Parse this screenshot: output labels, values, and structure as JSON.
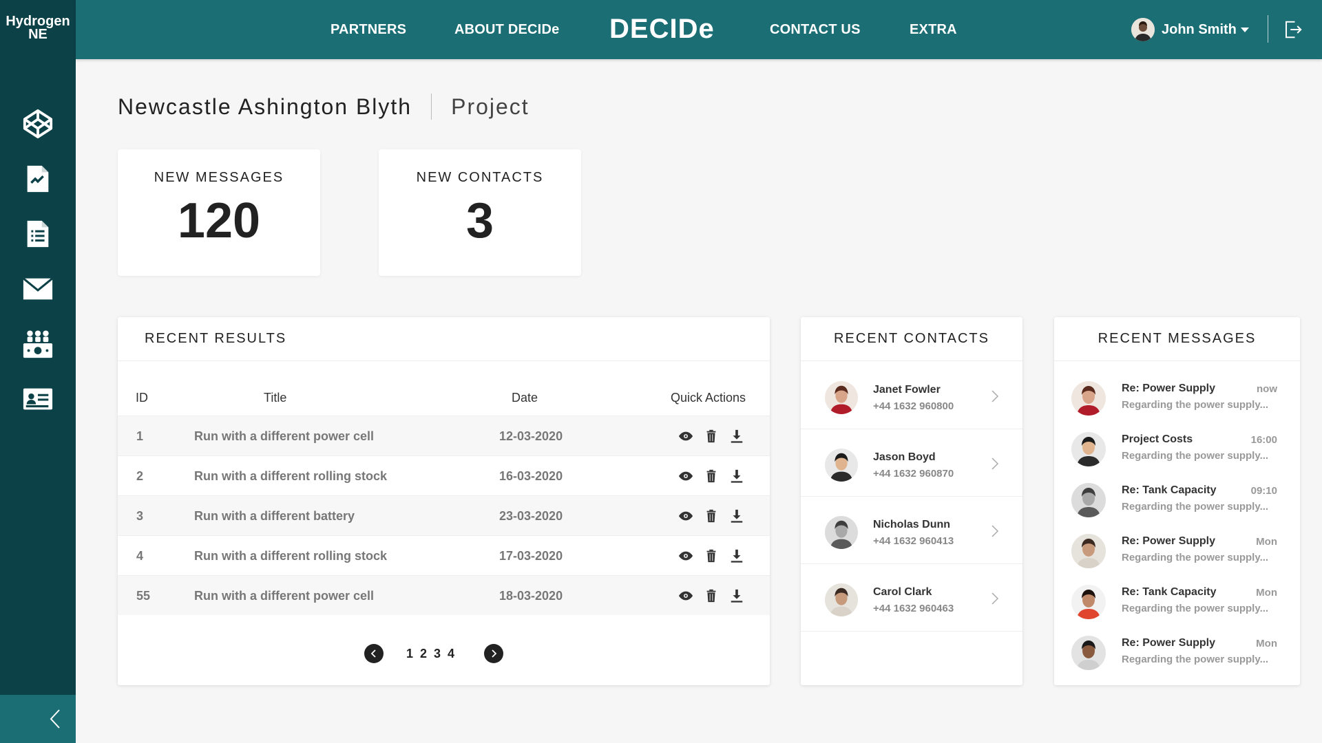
{
  "brand": {
    "line1": "Hydrogen",
    "line2": "NE"
  },
  "nav": {
    "partners": "PARTNERS",
    "about": "ABOUT DECIDe",
    "logo": "DECIDe",
    "contact": "CONTACT US",
    "extra": "EXTRA"
  },
  "user": {
    "name": "John Smith"
  },
  "sidebar": {
    "icons": [
      "codepen-icon",
      "chart-document-icon",
      "list-document-icon",
      "mail-icon",
      "users-money-icon",
      "contact-card-icon"
    ]
  },
  "header": {
    "title": "Newcastle Ashington Blyth",
    "subtitle": "Project"
  },
  "stats": {
    "messages": {
      "label": "NEW MESSAGES",
      "value": "120"
    },
    "contacts": {
      "label": "NEW CONTACTS",
      "value": "3"
    }
  },
  "results": {
    "title": "RECENT RESULTS",
    "columns": {
      "id": "ID",
      "title": "Title",
      "date": "Date",
      "actions": "Quick Actions"
    },
    "rows": [
      {
        "id": "1",
        "title": "Run with a different power cell",
        "date": "12-03-2020"
      },
      {
        "id": "2",
        "title": "Run with a different rolling stock",
        "date": "16-03-2020"
      },
      {
        "id": "3",
        "title": "Run with a different battery",
        "date": "23-03-2020"
      },
      {
        "id": "4",
        "title": "Run with a different rolling stock",
        "date": "17-03-2020"
      },
      {
        "id": "55",
        "title": "Run with a different power cell",
        "date": "18-03-2020"
      }
    ],
    "pages": [
      "1",
      "2",
      "3",
      "4"
    ]
  },
  "contacts": {
    "title": "RECENT CONTACTS",
    "items": [
      {
        "name": "Janet Fowler",
        "phone": "+44 1632 960800"
      },
      {
        "name": "Jason Boyd",
        "phone": "+44 1632 960870"
      },
      {
        "name": "Nicholas Dunn",
        "phone": "+44 1632 960413"
      },
      {
        "name": "Carol Clark",
        "phone": "+44 1632 960463"
      }
    ]
  },
  "messages": {
    "title": "RECENT MESSAGES",
    "items": [
      {
        "subject": "Re: Power Supply",
        "time": "now",
        "preview": "Regarding the power supply..."
      },
      {
        "subject": "Project Costs",
        "time": "16:00",
        "preview": "Regarding the power supply..."
      },
      {
        "subject": "Re: Tank Capacity",
        "time": "09:10",
        "preview": "Regarding the power supply..."
      },
      {
        "subject": "Re: Power Supply",
        "time": "Mon",
        "preview": "Regarding the power supply..."
      },
      {
        "subject": "Re: Tank Capacity",
        "time": "Mon",
        "preview": "Regarding the power supply..."
      },
      {
        "subject": "Re: Power Supply",
        "time": "Mon",
        "preview": "Regarding the power supply..."
      }
    ]
  },
  "colors": {
    "sidebar": "#0c4148",
    "topbar": "#1b6e74",
    "background": "#f6f6f6"
  }
}
